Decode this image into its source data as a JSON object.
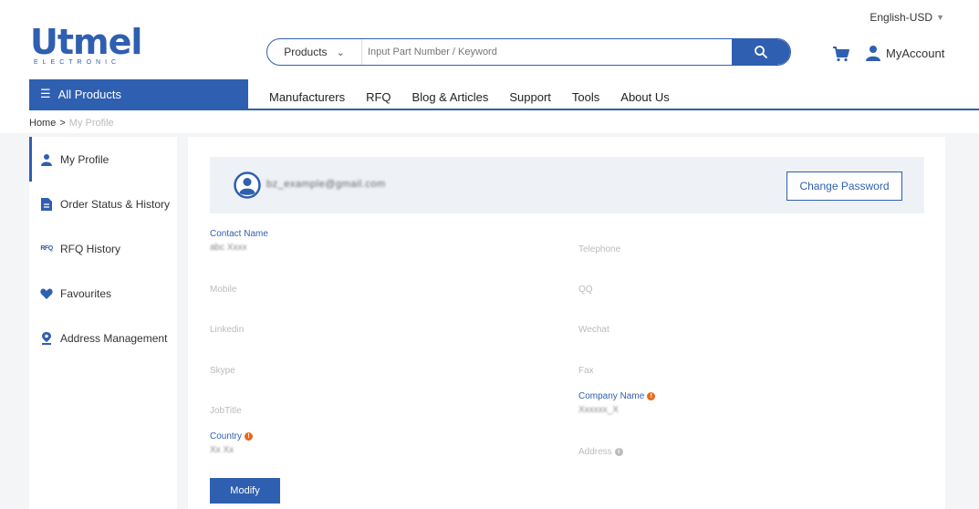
{
  "header": {
    "language": "English-USD",
    "logo_word": "Utmel",
    "logo_sub": "ELECTRONIC",
    "search": {
      "category": "Products",
      "placeholder": "Input Part Number / Keyword"
    },
    "account_label": "MyAccount"
  },
  "nav": {
    "all_products": "All Products",
    "items": [
      "Manufacturers",
      "RFQ",
      "Blog & Articles",
      "Support",
      "Tools",
      "About Us"
    ]
  },
  "breadcrumb": {
    "home": "Home",
    "separator": ">",
    "current": "My Profile"
  },
  "sidebar": {
    "items": [
      {
        "label": "My Profile",
        "icon": "user-icon"
      },
      {
        "label": "Order Status & History",
        "icon": "order-icon"
      },
      {
        "label": "RFQ History",
        "icon": "rfq-icon"
      },
      {
        "label": "Favourites",
        "icon": "heart-icon"
      },
      {
        "label": "Address Management",
        "icon": "location-icon"
      }
    ]
  },
  "profile": {
    "email": "bz_example@gmail.com",
    "change_password": "Change Password",
    "fields": {
      "contact_name": {
        "label": "Contact Name",
        "value": "abc Xxxx"
      },
      "telephone": {
        "label": "Telephone"
      },
      "mobile": {
        "label": "Mobile"
      },
      "qq": {
        "label": "QQ"
      },
      "linkedin": {
        "label": "Linkedin"
      },
      "wechat": {
        "label": "Wechat"
      },
      "skype": {
        "label": "Skype"
      },
      "fax": {
        "label": "Fax"
      },
      "jobtitle": {
        "label": "JobTitle"
      },
      "company_name": {
        "label": "Company Name",
        "value": "Xxxxxx_X"
      },
      "country": {
        "label": "Country",
        "value": "Xx Xx"
      },
      "address": {
        "label": "Address"
      }
    },
    "modify": "Modify"
  },
  "colors": {
    "brand": "#2f5fb0",
    "warning": "#e8681c",
    "panel": "#eef1f6",
    "page_bg": "#f4f5f7"
  }
}
